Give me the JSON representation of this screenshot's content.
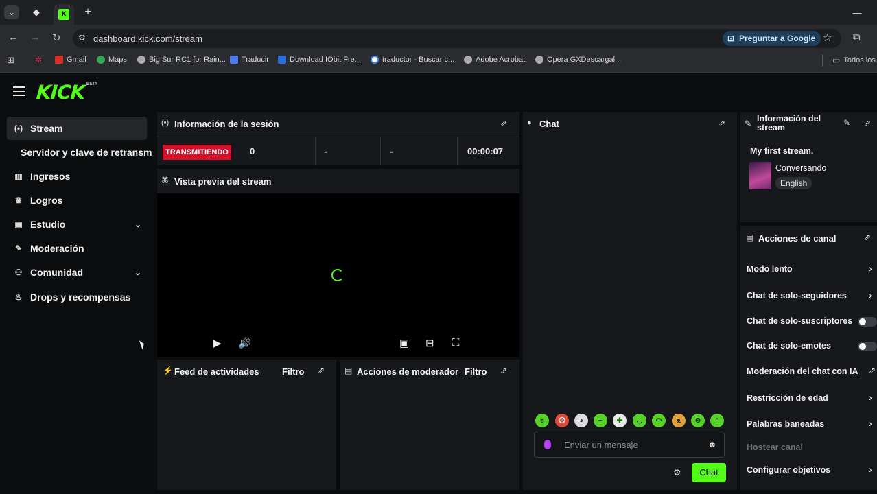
{
  "browser": {
    "url": "dashboard.kick.com/stream",
    "google_button": "Preguntar a Google",
    "bookmarks": [
      "Gmail",
      "Maps",
      "Big Sur RC1 for Rain...",
      "Traducir",
      "Download IObit Fre...",
      "traductor - Buscar c...",
      "Adobe Acrobat",
      "Opera GXDescargal...",
      "Todos los"
    ],
    "new_tab": "+",
    "minimize": "—"
  },
  "app": {
    "logo": "KICK",
    "logo_badge": "BETA"
  },
  "sidebar": {
    "items": [
      {
        "label": "Stream",
        "icon": "stream-icon"
      },
      {
        "label": "Servidor y clave de retransm",
        "icon": ""
      },
      {
        "label": "Ingresos",
        "icon": "chart-icon"
      },
      {
        "label": "Logros",
        "icon": "trophy-icon"
      },
      {
        "label": "Estudio",
        "icon": "studio-icon"
      },
      {
        "label": "Moderación",
        "icon": "wrench-icon"
      },
      {
        "label": "Comunidad",
        "icon": "community-icon"
      },
      {
        "label": "Drops y recompensas",
        "icon": "gift-icon"
      }
    ]
  },
  "session": {
    "title": "Información de la sesión",
    "status": "TRANSMITIENDO",
    "viewers": "0",
    "stat2": "-",
    "stat3": "-",
    "duration": "00:00:07"
  },
  "preview": {
    "title": "Vista previa del stream"
  },
  "activity": {
    "title": "Feed de actividades",
    "filter": "Filtro"
  },
  "mod_actions": {
    "title": "Acciones de moderador",
    "filter": "Filtro"
  },
  "chat": {
    "title": "Chat",
    "placeholder": "Enviar un mensaje",
    "send_label": "Chat"
  },
  "stream_info": {
    "title": "Información del stream",
    "stream_title": "My first stream.",
    "category": "Conversando",
    "language": "English"
  },
  "channel_actions": {
    "title": "Acciones de canal",
    "items": [
      {
        "label": "Modo lento",
        "control": "arrow"
      },
      {
        "label": "Chat de solo-seguidores",
        "control": "arrow"
      },
      {
        "label": "Chat de solo-suscriptores",
        "control": "toggle"
      },
      {
        "label": "Chat de solo-emotes",
        "control": "toggle"
      },
      {
        "label": "Moderación del chat con IA",
        "control": "popout"
      },
      {
        "label": "Restricción de edad",
        "control": "arrow"
      },
      {
        "label": "Palabras baneadas",
        "control": "arrow"
      },
      {
        "label": "Hostear canal",
        "control": "none"
      },
      {
        "label": "Configurar objetivos",
        "control": "arrow"
      }
    ]
  },
  "colors": {
    "accent": "#53fc18",
    "live": "#d6102b",
    "panel": "#17181b",
    "background": "#0b0c0e"
  }
}
